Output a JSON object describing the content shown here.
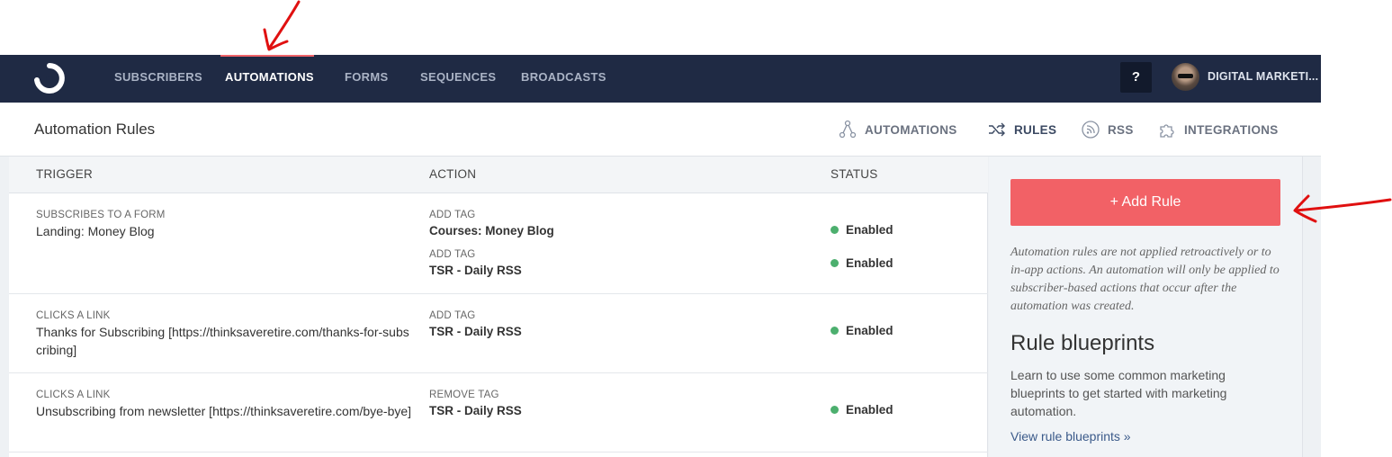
{
  "nav": {
    "items": [
      {
        "label": "SUBSCRIBERS"
      },
      {
        "label": "AUTOMATIONS"
      },
      {
        "label": "FORMS"
      },
      {
        "label": "SEQUENCES"
      },
      {
        "label": "BROADCASTS"
      }
    ],
    "active": "AUTOMATIONS",
    "help_label": "?",
    "account_name": "DIGITAL MARKETI..."
  },
  "subheader": {
    "title": "Automation Rules",
    "tabs": [
      {
        "label": "AUTOMATIONS",
        "icon": "automation-tree-icon"
      },
      {
        "label": "RULES",
        "icon": "shuffle-icon"
      },
      {
        "label": "RSS",
        "icon": "rss-icon"
      },
      {
        "label": "INTEGRATIONS",
        "icon": "puzzle-icon"
      }
    ],
    "active_tab": "RULES"
  },
  "table": {
    "headers": {
      "trigger": "TRIGGER",
      "action": "ACTION",
      "status": "STATUS"
    },
    "rows": [
      {
        "trigger_type": "SUBSCRIBES TO A FORM",
        "trigger_value": "Landing: Money Blog",
        "actions": [
          {
            "type": "ADD TAG",
            "value": "Courses: Money Blog",
            "status": "Enabled"
          },
          {
            "type": "ADD TAG",
            "value": "TSR - Daily RSS",
            "status": "Enabled"
          }
        ]
      },
      {
        "trigger_type": "CLICKS A LINK",
        "trigger_value": "Thanks for Subscribing [https://thinksaveretire.com/thanks-for-subscribing]",
        "actions": [
          {
            "type": "ADD TAG",
            "value": "TSR - Daily RSS",
            "status": "Enabled"
          }
        ]
      },
      {
        "trigger_type": "CLICKS A LINK",
        "trigger_value": "Unsubscribing from newsletter [https://thinksaveretire.com/bye-bye]",
        "actions": [
          {
            "type": "REMOVE TAG",
            "value": "TSR - Daily RSS",
            "status": "Enabled"
          }
        ]
      }
    ]
  },
  "sidebar": {
    "add_rule_label": "+ Add Rule",
    "note": "Automation rules are not applied retroactively or to in-app actions. An automation will only be applied to subscriber-based actions that occur after the automation was created.",
    "blueprints_title": "Rule blueprints",
    "blueprints_text": "Learn to use some common marketing blueprints to get started with marketing automation.",
    "blueprints_link": "View rule blueprints »"
  },
  "colors": {
    "nav_bg": "#1f2a44",
    "accent": "#f26166",
    "enabled": "#4caf6e",
    "annotation": "#e01010"
  }
}
